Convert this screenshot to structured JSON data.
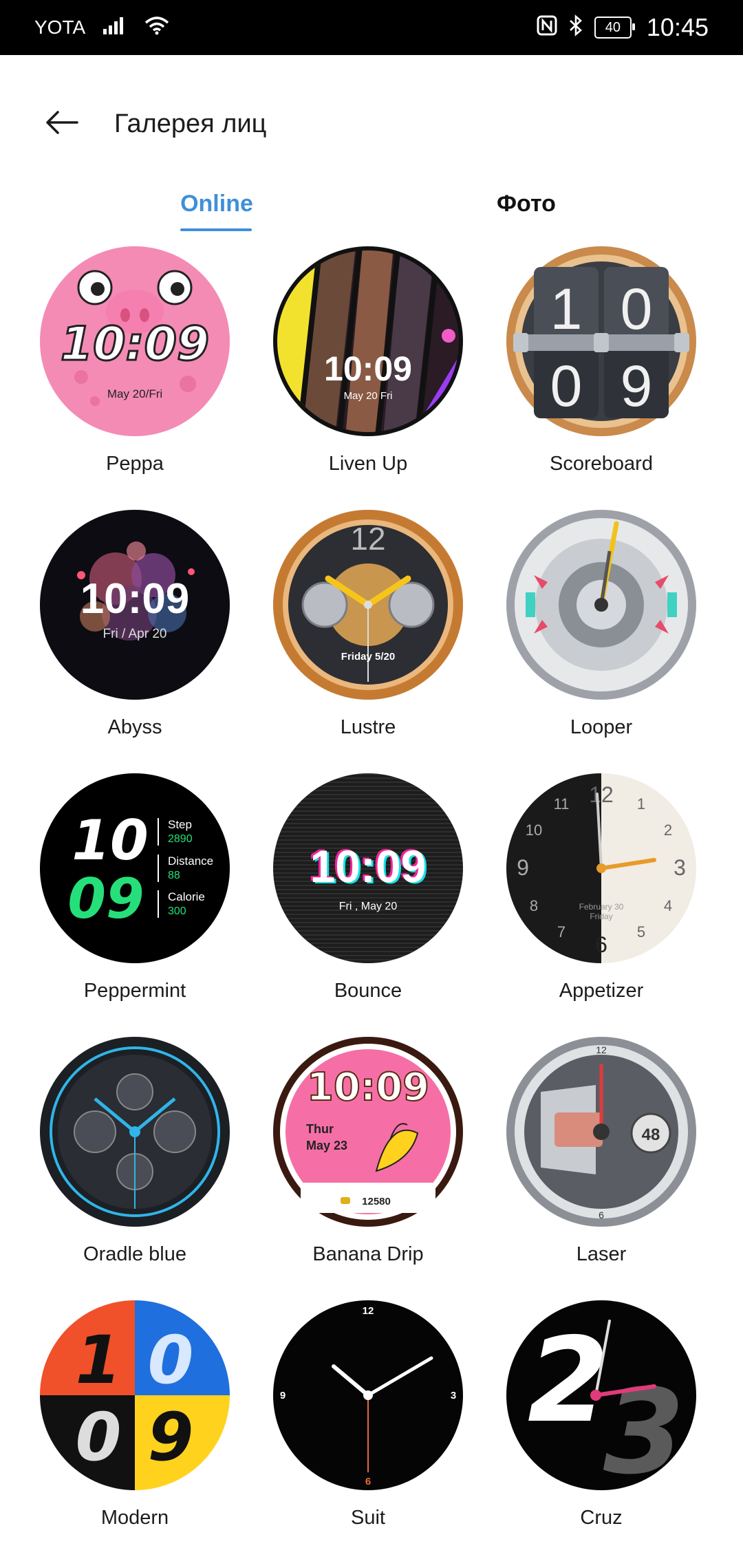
{
  "status_bar": {
    "carrier": "YOTA",
    "battery": "40",
    "time": "10:45"
  },
  "header": {
    "title": "Галерея лиц"
  },
  "tabs": [
    {
      "label": "Online",
      "active": true
    },
    {
      "label": "Фото",
      "active": false
    }
  ],
  "faces": [
    {
      "name": "Peppa",
      "time": "10:09",
      "date": "May 20/Fri"
    },
    {
      "name": "Liven Up",
      "time": "10:09",
      "date": "May 20 Fri"
    },
    {
      "name": "Scoreboard",
      "digits": [
        "1",
        "0",
        "0",
        "9"
      ]
    },
    {
      "name": "Abyss",
      "time": "10:09",
      "date": "Fri / Apr 20"
    },
    {
      "name": "Lustre",
      "numeral": "12",
      "date": "Friday 5/20"
    },
    {
      "name": "Looper"
    },
    {
      "name": "Peppermint",
      "hour": "10",
      "minute": "09",
      "stats": [
        {
          "label": "Step",
          "value": "2890"
        },
        {
          "label": "Distance",
          "value": "88"
        },
        {
          "label": "Calorie",
          "value": "300"
        }
      ]
    },
    {
      "name": "Bounce",
      "time": "10:09",
      "date": "Fri , May 20"
    },
    {
      "name": "Appetizer",
      "numerals": [
        "12",
        "1",
        "2",
        "3",
        "4",
        "5",
        "6",
        "7",
        "8",
        "9",
        "10",
        "11"
      ],
      "date_line1": "February 30",
      "date_line2": "Friday"
    },
    {
      "name": "Oradle blue"
    },
    {
      "name": "Banana Drip",
      "time": "10:09",
      "day": "Thur",
      "date": "May 23",
      "steps": "12580"
    },
    {
      "name": "Laser",
      "numerals": [
        "12",
        "48",
        "6"
      ]
    },
    {
      "name": "Modern",
      "digits": [
        "1",
        "0",
        "0",
        "9"
      ]
    },
    {
      "name": "Suit",
      "numerals": [
        "12",
        "3",
        "6",
        "9"
      ]
    },
    {
      "name": "Cruz",
      "digits": [
        "2",
        "3"
      ]
    }
  ],
  "colors": {
    "accent": "#3f8fd8",
    "peppa_pink": "#f48bb5",
    "peppermint_green": "#25e07a",
    "modern_red": "#f0502a",
    "modern_blue": "#1f6fde",
    "modern_yellow": "#ffd21e",
    "banana_pink": "#f56fa6"
  },
  "icons": [
    "back-arrow-icon",
    "signal-icon",
    "wifi-icon",
    "nfc-icon",
    "bluetooth-icon",
    "battery-icon"
  ]
}
